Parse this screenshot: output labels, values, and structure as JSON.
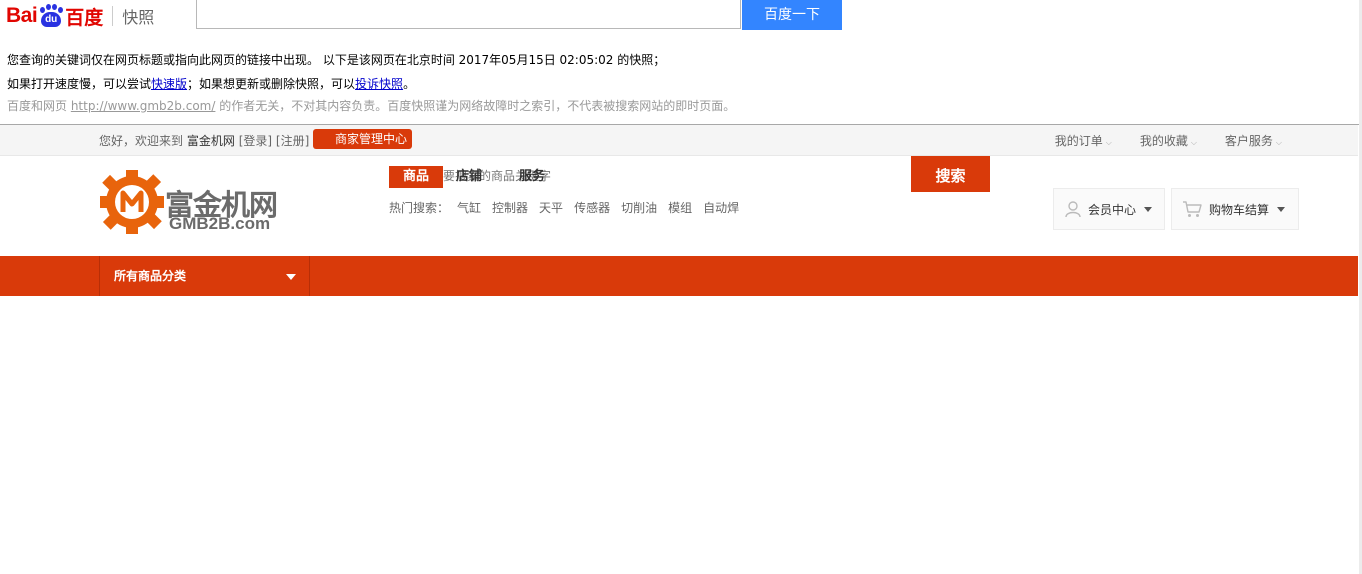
{
  "baidu": {
    "logo_text_left": "Bai",
    "logo_paw_text": "du",
    "logo_text_cn": "百度",
    "snapshot_label": "快照",
    "search_button": "百度一下",
    "line1": "您查询的关键词仅在网页标题或指向此网页的链接中出现。  以下是该网页在北京时间 2017年05月15日 02:05:02 的快照；",
    "line2_prefix": "如果打开速度慢，可以尝试",
    "line2_fast_link": "快速版",
    "line2_middle": "；如果想更新或删除快照，可以",
    "line2_complain_link": "投诉快照",
    "line2_suffix": "。",
    "line3_prefix": "百度和网页 ",
    "line3_url": "http://www.gmb2b.com/",
    "line3_suffix": " 的作者无关，不对其内容负责。百度快照谨为网络故障时之索引，不代表被搜索网站的即时页面。"
  },
  "topbar": {
    "greeting": "您好，欢迎来到",
    "site_name": "富金机网",
    "login": "[登录]",
    "register": "[注册]",
    "merchant_center": "商家管理中心",
    "right_links": [
      {
        "label": "我的订单"
      },
      {
        "label": "我的收藏"
      },
      {
        "label": "客户服务"
      }
    ]
  },
  "header": {
    "logo_cn": "富金机网",
    "logo_en": "GMB2B.com",
    "search_tabs": [
      "商品",
      "店铺",
      "服务"
    ],
    "search_placeholder": "要搜索的商品关键字",
    "search_button": "搜索",
    "hot_label": "热门搜索：",
    "hot_keywords": [
      "气缸",
      "控制器",
      "天平",
      "传感器",
      "切削油",
      "模组",
      "自动焊"
    ],
    "member_center": "会员中心",
    "cart": "购物车结算"
  },
  "nav": {
    "all_categories": "所有商品分类"
  },
  "colors": {
    "brand": "#d93a0a",
    "baidu_blue": "#3385ff",
    "baidu_red": "#e10601"
  }
}
